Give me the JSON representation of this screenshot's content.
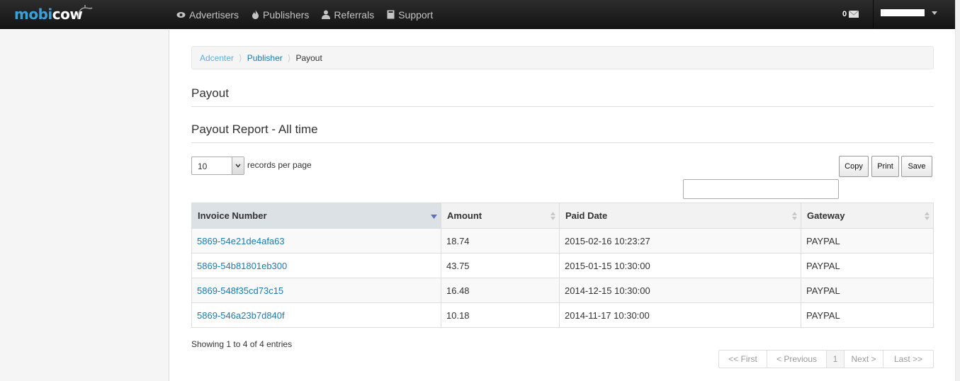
{
  "brand": {
    "part1": "mobi",
    "part2": "cow"
  },
  "nav": [
    {
      "label": "Advertisers",
      "icon": "eye-icon"
    },
    {
      "label": "Publishers",
      "icon": "fire-icon"
    },
    {
      "label": "Referrals",
      "icon": "user-icon"
    },
    {
      "label": "Support",
      "icon": "book-icon"
    }
  ],
  "mail": {
    "count": "0",
    "icon": "envelope-icon"
  },
  "breadcrumb": {
    "items": [
      "Adcenter",
      "Publisher"
    ],
    "current": "Payout"
  },
  "page_title": "Payout",
  "report_title": "Payout Report - All time",
  "table_controls": {
    "length_value": "10",
    "length_label": "records per page",
    "buttons": [
      "Copy",
      "Print",
      "Save"
    ],
    "search_value": ""
  },
  "table": {
    "columns": [
      "Invoice Number",
      "Amount",
      "Paid Date",
      "Gateway"
    ],
    "rows": [
      {
        "invoice": "5869-54e21de4afa63",
        "amount": "18.74",
        "paid_date": "2015-02-16 10:23:27",
        "gateway": "PAYPAL"
      },
      {
        "invoice": "5869-54b81801eb300",
        "amount": "43.75",
        "paid_date": "2015-01-15 10:30:00",
        "gateway": "PAYPAL"
      },
      {
        "invoice": "5869-548f35cd73c15",
        "amount": "16.48",
        "paid_date": "2014-12-15 10:30:00",
        "gateway": "PAYPAL"
      },
      {
        "invoice": "5869-546a23b7d840f",
        "amount": "10.18",
        "paid_date": "2014-11-17 10:30:00",
        "gateway": "PAYPAL"
      }
    ]
  },
  "info": "Showing 1 to 4 of 4 entries",
  "pagination": {
    "first": "<< First",
    "previous": "< Previous",
    "page": "1",
    "next": "Next >",
    "last": "Last >>"
  },
  "colors": {
    "navbar": "#1b1b1b",
    "link": "#1a7bb0",
    "brand": "#3aa0d8"
  }
}
